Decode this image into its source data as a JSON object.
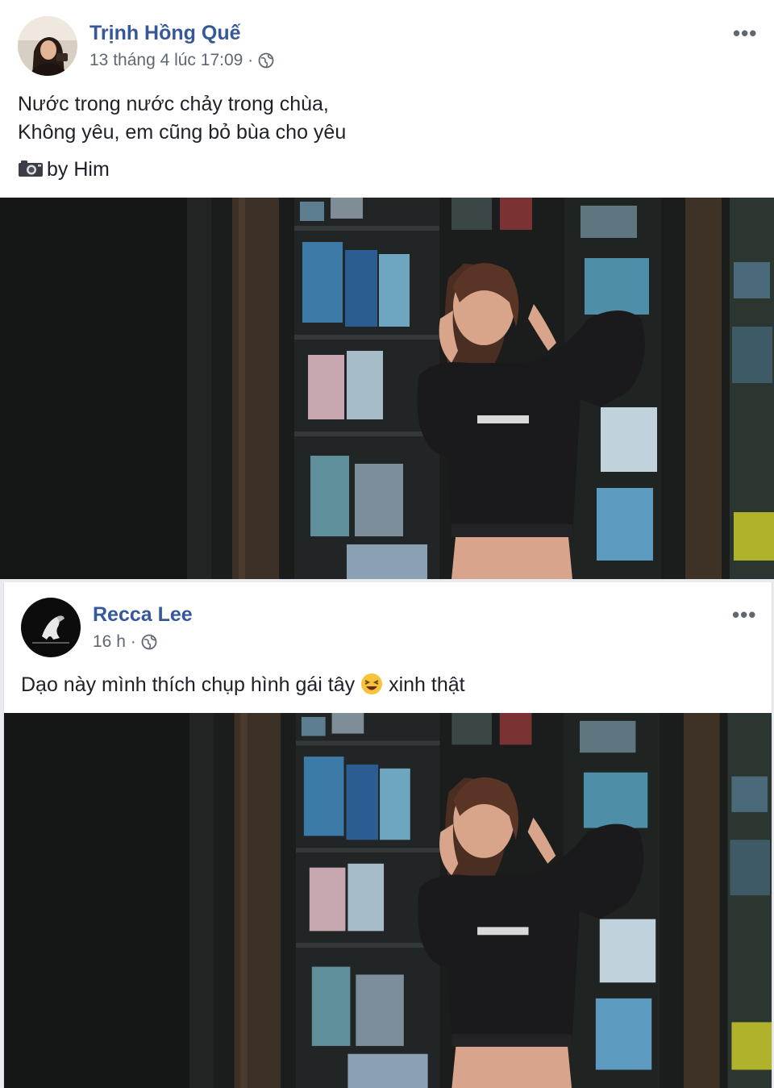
{
  "posts": [
    {
      "author": "Trịnh Hồng Quế",
      "time": "13 tháng 4 lúc 17:09 ·",
      "lines": [
        "Nước trong nước chảy trong chùa,",
        "Không yêu, em cũng bỏ bùa cho yêu"
      ],
      "credit": "by Him",
      "credit_icon": "camera-icon"
    },
    {
      "author": "Recca Lee",
      "time": "16 h ·",
      "text_before": "Dạo này mình thích chụp hình gái tây",
      "emoji": "laughing-emoji-icon",
      "text_after": "xinh thật"
    }
  ],
  "more_label": "•••"
}
